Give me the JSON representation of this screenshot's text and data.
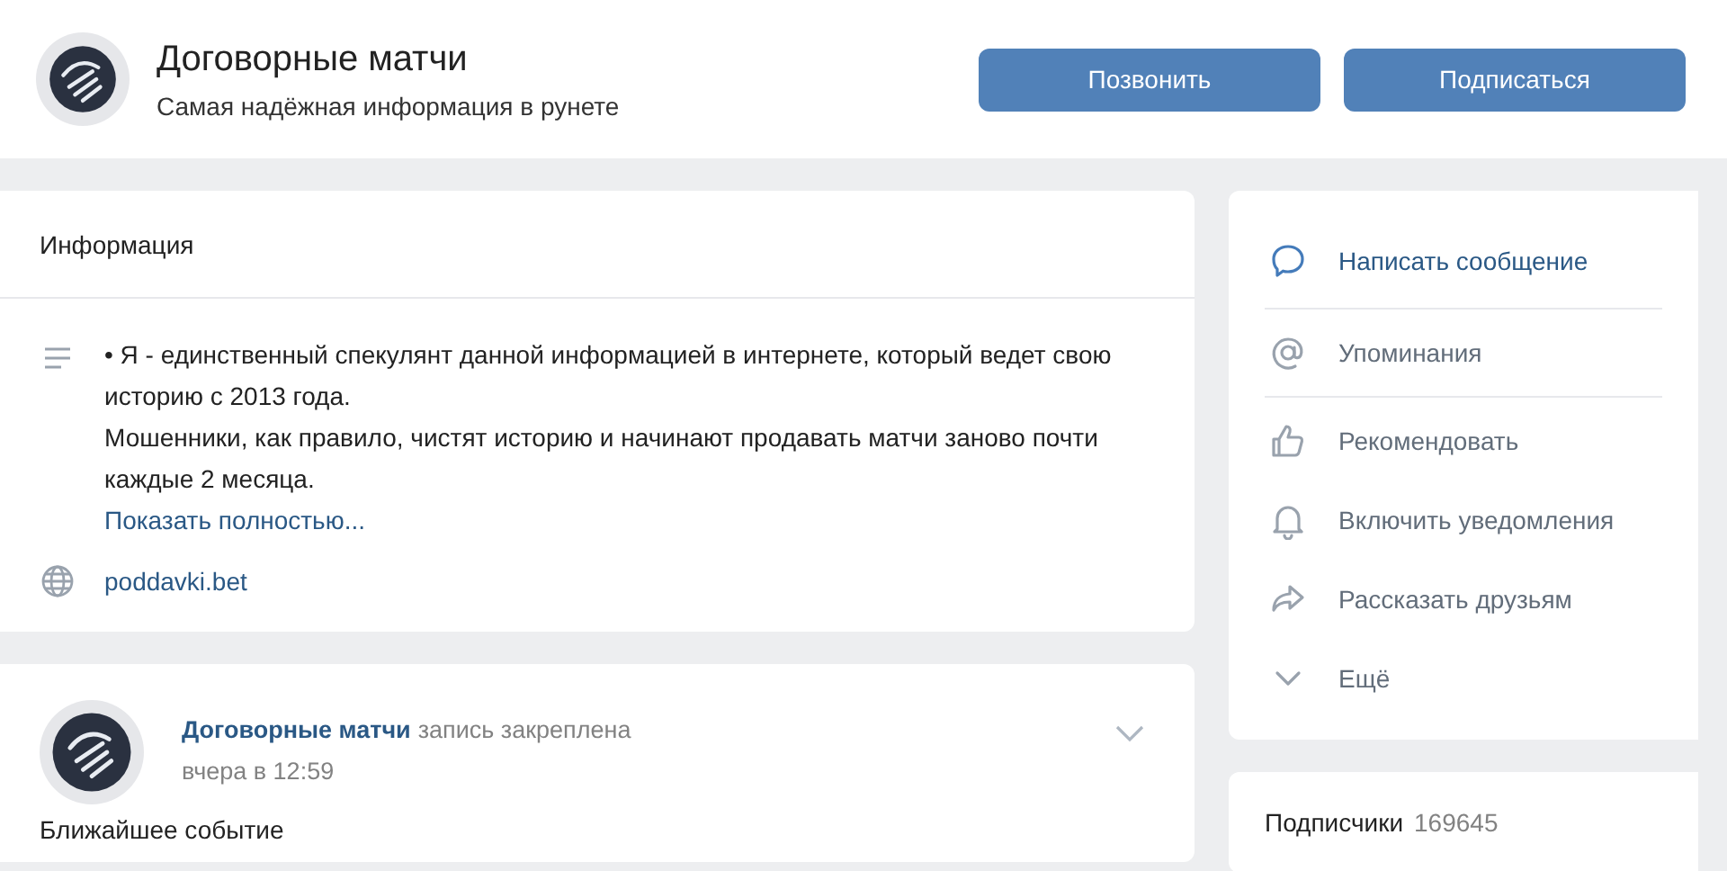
{
  "header": {
    "title": "Договорные матчи",
    "status": "Самая надёжная информация в рунете",
    "buttons": [
      "Позвонить",
      "Подписаться"
    ]
  },
  "info": {
    "title": "Информация",
    "description": [
      "• Я - единственный спекулянт данной информацией в интернете, который ведет свою историю с 2013 года.",
      "Мошенники, как правило, чистят историю и начинают продавать матчи заново почти каждые 2 месяца."
    ],
    "more_link": "Показать полностью...",
    "website": "poddavki.bet"
  },
  "post": {
    "author": "Договорные матчи",
    "note": "запись закреплена",
    "time": "вчера в 12:59",
    "text": "Ближайшее событие"
  },
  "actions": [
    [
      {
        "label": "Написать сообщение",
        "kind": "accent"
      }
    ],
    [
      {
        "label": "Упоминания",
        "kind": "plain"
      }
    ],
    [
      {
        "label": "Рекомендовать",
        "kind": "plain"
      },
      {
        "label": "Включить уведомления",
        "kind": "plain"
      },
      {
        "label": "Рассказать друзьям",
        "kind": "plain"
      },
      {
        "label": "Ещё",
        "kind": "plain"
      }
    ]
  ],
  "subscribers": {
    "label": "Подписчики",
    "count": "169645"
  }
}
